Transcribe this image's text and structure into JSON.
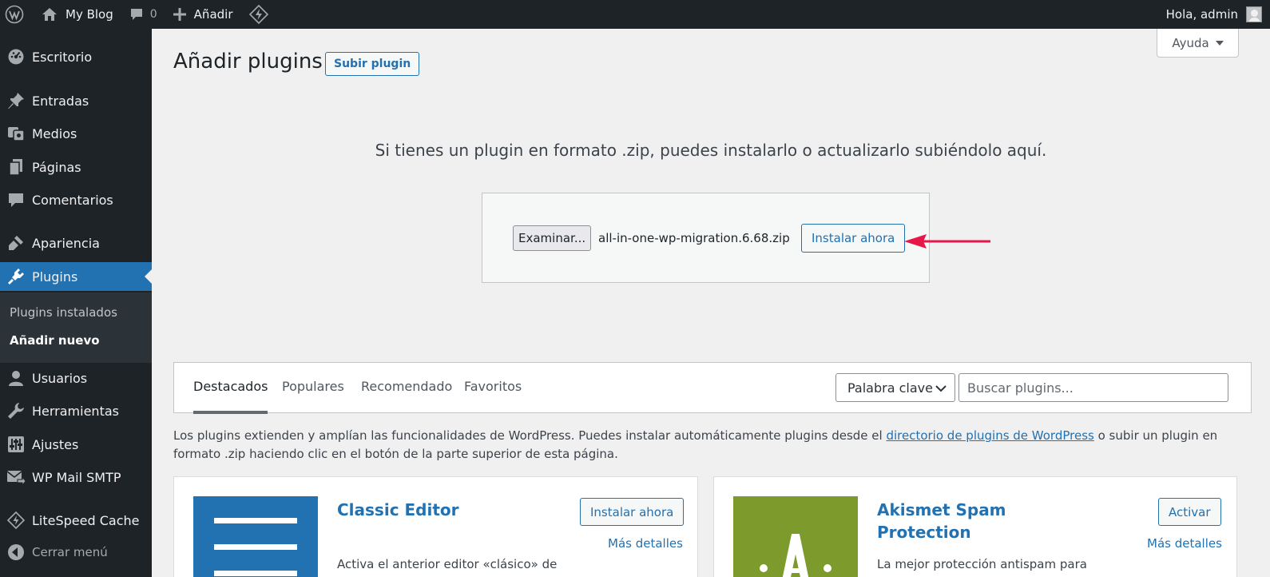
{
  "admin_bar": {
    "site_name": "My Blog",
    "comments_count": "0",
    "new_label": "Añadir",
    "greeting": "Hola, admin"
  },
  "sidebar": {
    "items": [
      {
        "label": "Escritorio",
        "icon": "dashboard-icon"
      },
      {
        "label": "Entradas",
        "icon": "pin-icon"
      },
      {
        "label": "Medios",
        "icon": "media-icon"
      },
      {
        "label": "Páginas",
        "icon": "pages-icon"
      },
      {
        "label": "Comentarios",
        "icon": "comments-icon"
      },
      {
        "label": "Apariencia",
        "icon": "appearance-icon"
      },
      {
        "label": "Plugins",
        "icon": "plugins-icon"
      },
      {
        "label": "Usuarios",
        "icon": "users-icon"
      },
      {
        "label": "Herramientas",
        "icon": "tools-icon"
      },
      {
        "label": "Ajustes",
        "icon": "settings-icon"
      },
      {
        "label": "WP Mail SMTP",
        "icon": "mail-icon"
      },
      {
        "label": "LiteSpeed Cache",
        "icon": "litespeed-icon"
      },
      {
        "label": "Cerrar menú",
        "icon": "collapse-icon"
      }
    ],
    "submenu": [
      "Plugins instalados",
      "Añadir nuevo"
    ]
  },
  "main": {
    "title": "Añadir plugins",
    "upload_button": "Subir plugin",
    "help_button": "Ayuda",
    "upload_description": "Si tienes un plugin en formato .zip, puedes instalarlo o actualizarlo subiéndolo aquí.",
    "browse_button": "Examinar...",
    "file_name": "all-in-one-wp-migration.6.68.zip",
    "install_button": "Instalar ahora"
  },
  "filter": {
    "tabs": [
      "Destacados",
      "Populares",
      "Recomendado",
      "Favoritos"
    ],
    "search_type": "Palabra clave",
    "search_placeholder": "Buscar plugins..."
  },
  "intro": {
    "before_link": "Los plugins extienden y amplían las funcionalidades de WordPress. Puedes instalar automáticamente plugins desde el ",
    "link": "directorio de plugins de WordPress",
    "after_link": " o subir un plugin en formato .zip haciendo clic en el botón de la parte superior de esta página."
  },
  "plugins": [
    {
      "name": "Classic Editor",
      "action": "Instalar ahora",
      "more": "Más detalles",
      "description": "Activa el anterior editor «clásico» de WordPress y el diseño tradicional de la",
      "icon_color": "#2271b1"
    },
    {
      "name": "Akismet Spam Protection",
      "action": "Activar",
      "more": "Más detalles",
      "description": "La mejor protección antispam para",
      "icon_color": "#7d9b2c",
      "icon_letter": "A"
    }
  ],
  "colors": {
    "admin_bar": "#1d2327",
    "accent": "#2271b1",
    "annotation_arrow": "#e8174a"
  }
}
